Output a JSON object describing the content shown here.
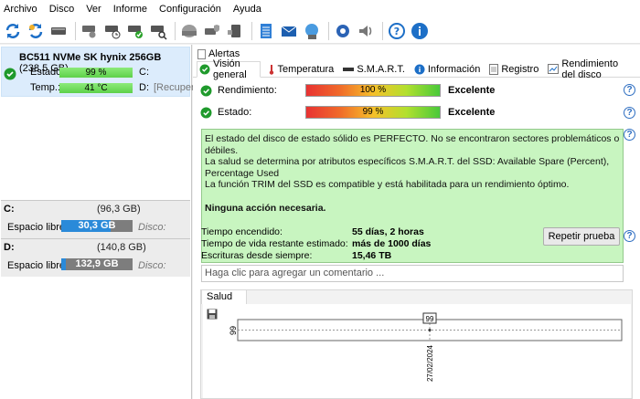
{
  "menu": [
    "Archivo",
    "Disco",
    "Ver",
    "Informe",
    "Configuración",
    "Ayuda"
  ],
  "toolbar_icons": [
    "refresh-icon",
    "refresh-alert-icon",
    "drive-icon",
    "drive-settings-icon",
    "drive-clock-icon",
    "drive-check-icon",
    "drive-search-icon",
    "drive-gray-icon",
    "drive-shield-icon",
    "drive-usb-icon",
    "notepad-icon",
    "mail-icon",
    "network-globe-icon",
    "gear-icon",
    "speaker-icon",
    "help-icon",
    "info-icon"
  ],
  "disk": {
    "name": "BC511 NVMe SK hynix 256GB",
    "size": "(238,5 GB)",
    "estado_label": "Estado:",
    "estado_value": "99 %",
    "temp_label": "Temp.:",
    "temp_value": "41 °C",
    "vol_c": "C:",
    "vol_d": "D:",
    "recup": "[Recupera"
  },
  "volumes": [
    {
      "letter": "C:",
      "capacity": "(96,3 GB)",
      "free_label": "Espacio libre",
      "free": "30,3 GB",
      "used_fraction": 0.69,
      "disco": "Disco:"
    },
    {
      "letter": "D:",
      "capacity": "(140,8 GB)",
      "free_label": "Espacio libre",
      "free": "132,9 GB",
      "used_fraction": 0.06,
      "disco": "Disco:"
    }
  ],
  "tabs_top": "Alertas",
  "tabs": [
    "Visión general",
    "Temperatura",
    "S.M.A.R.T.",
    "Información",
    "Registro",
    "Rendimiento del disco"
  ],
  "status": {
    "rendimiento_label": "Rendimiento:",
    "rendimiento_value": "100 %",
    "rendimiento_fraction": 1.0,
    "rendimiento_verdict": "Excelente",
    "estado_label": "Estado:",
    "estado_value": "99 %",
    "estado_fraction": 0.99,
    "estado_verdict": "Excelente"
  },
  "message": {
    "line1": "El estado del disco de estado sólido es PERFECTO. No se encontraron sectores problemáticos o débiles.",
    "line2": "La salud se determina por atributos específicos S.M.A.R.T. del SSD: Available Spare (Percent), Percentage Used",
    "line3": "La función TRIM del SSD es compatible y está habilitada para un rendimiento óptimo.",
    "bold": "Ninguna acción necesaria."
  },
  "info": {
    "encendido_label": "Tiempo encendido:",
    "encendido_value": "55 días, 2 horas",
    "vida_label": "Tiempo de vida restante estimado:",
    "vida_value": "más de 1000 días",
    "escrituras_label": "Escrituras desde siempre:",
    "escrituras_value": "15,46 TB"
  },
  "repeat_button": "Repetir prueba",
  "comment_placeholder": "Haga clic para agregar un comentario ...",
  "graph": {
    "tab": "Salud (%)",
    "y_tick": "99",
    "point_label": "99",
    "x_label": "27/02/2024"
  },
  "chart_data": {
    "type": "line",
    "x": [
      "27/02/2024"
    ],
    "values": [
      99
    ]
  }
}
